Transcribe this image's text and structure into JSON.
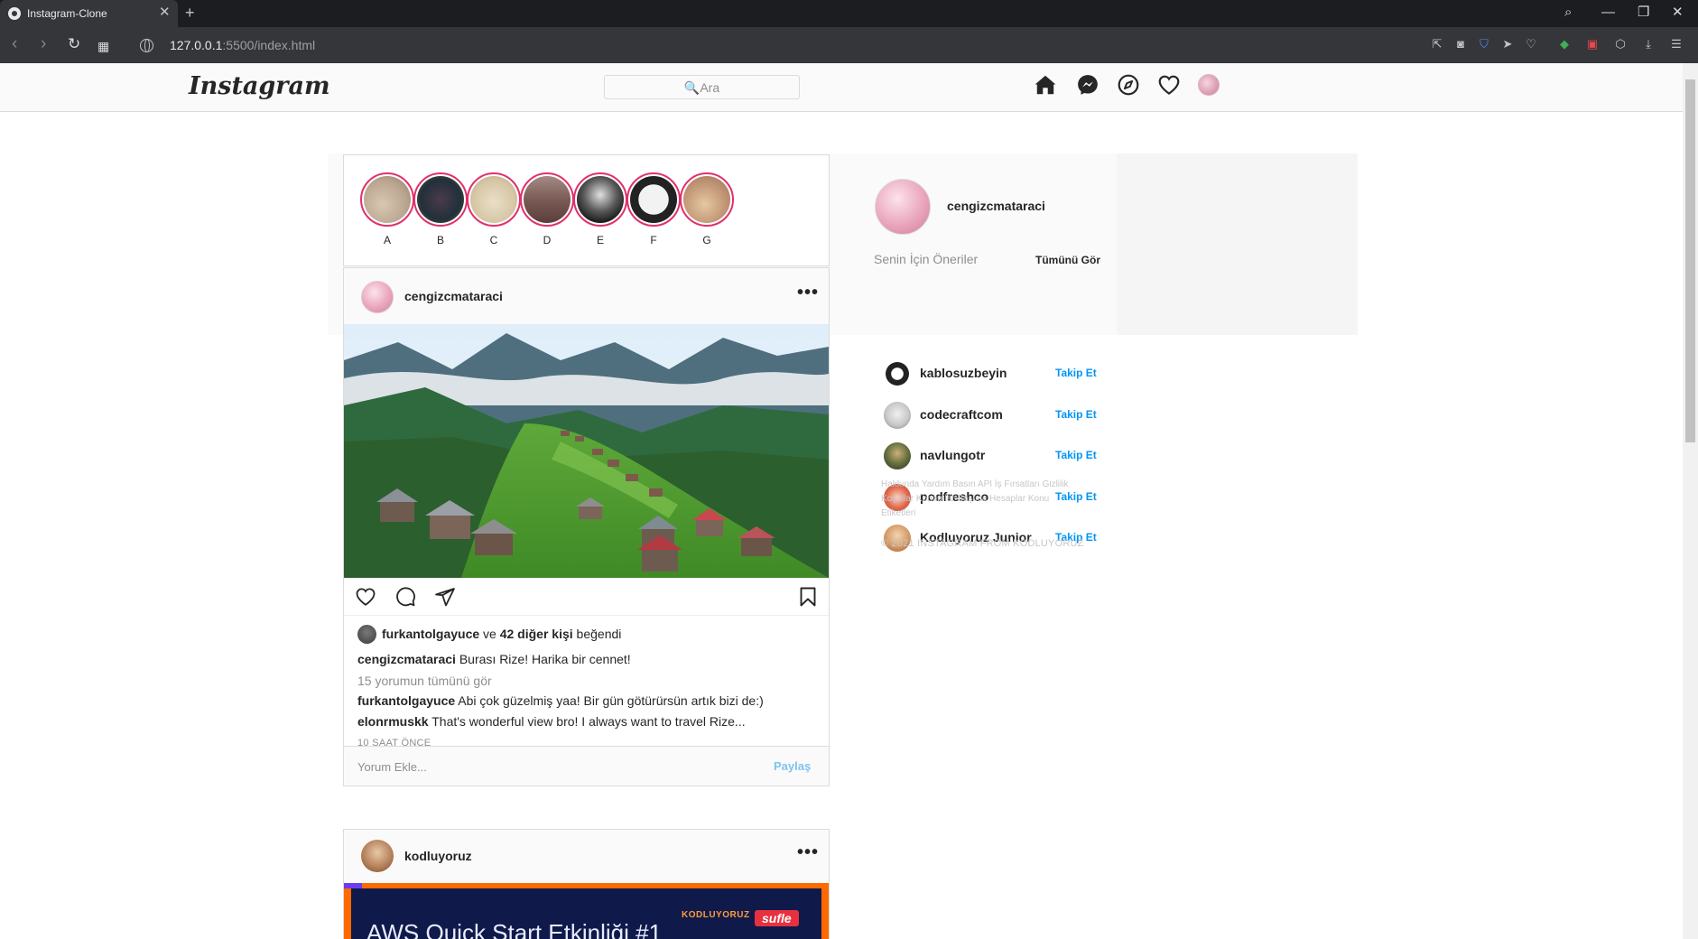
{
  "browser": {
    "tab_title": "Instagram-Clone",
    "url_host": "127.0.0.1",
    "url_path": ":5500/index.html"
  },
  "header": {
    "logo": "Instagram",
    "search_placeholder": "🔍Ara",
    "icons": [
      "home-icon",
      "messenger-icon",
      "explore-icon",
      "heart-icon"
    ]
  },
  "stories": [
    {
      "label": "A"
    },
    {
      "label": "B"
    },
    {
      "label": "C"
    },
    {
      "label": "D"
    },
    {
      "label": "E"
    },
    {
      "label": "F"
    },
    {
      "label": "G"
    }
  ],
  "post": {
    "username": "cengizcmataraci",
    "more": "•••",
    "liked_by_user": "furkantolgayuce",
    "liked_by_and": " ve ",
    "liked_by_others": "42 diğer kişi",
    "liked_by_suffix": " beğendi",
    "caption_user": "cengizcmataraci",
    "caption_text": " Burası Rize! Harika bir cennet!",
    "view_comments": "15 yorumun tümünü gör",
    "comments": [
      {
        "user": "furkantolgayuce",
        "text": " Abi çok güzelmiş yaa! Bir gün götürürsün artık bizi de:)"
      },
      {
        "user": "elonrmuskk",
        "text": " That's wonderful view bro! I always want to travel Rize..."
      }
    ],
    "time": "10 SAAT ÖNCE",
    "comment_placeholder": "Yorum Ekle...",
    "share_label": "Paylaş"
  },
  "post2": {
    "username": "kodluyoruz",
    "more": "•••",
    "banner_title": "AWS Quick Start Etkinliği #1",
    "banner_brand": "KODLUYORUZ",
    "banner_badge": "sufle"
  },
  "sidebar": {
    "username": "cengizcmataraci",
    "suggestions_title": "Senin İçin Öneriler",
    "see_all": "Tümünü Gör",
    "follow_label": "Takip Et",
    "suggestions": [
      {
        "name": "kablosuzbeyin"
      },
      {
        "name": "codecraftcom"
      },
      {
        "name": "navlungotr"
      },
      {
        "name": "podfreshco"
      },
      {
        "name": "Kodluyoruz Junior"
      }
    ],
    "footer_links": "Hakkında Yardım Basın API İş Fırsatları Gizlilik Koşullar Konumlar Başlıca Hesaplar Konu Etiketleri",
    "copyright": "© 2021 INSTAGRAM FROM KODLUYORUZ"
  }
}
